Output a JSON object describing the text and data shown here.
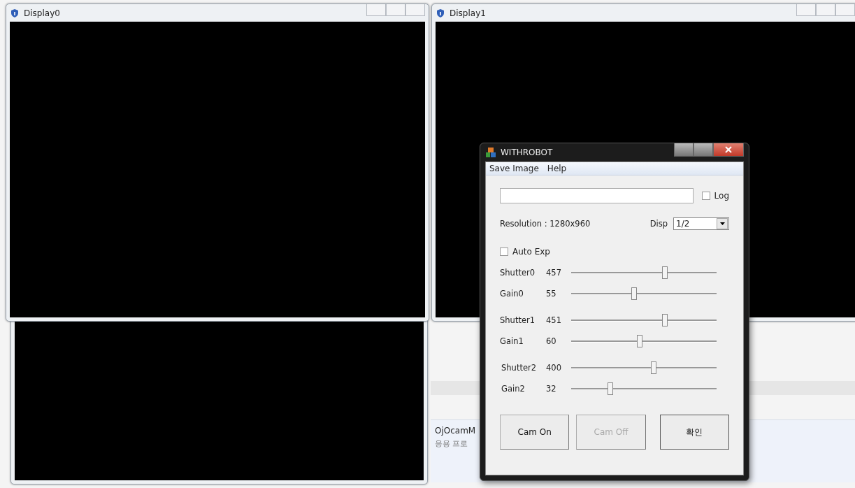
{
  "display_windows": [
    {
      "title": "Display0"
    },
    {
      "title": "Display1"
    }
  ],
  "background_item": {
    "title": "OjOcamM",
    "subtitle": "응용 프로"
  },
  "dialog": {
    "title": "WITHROBOT",
    "menu": [
      "Save Image",
      "Help"
    ],
    "log": {
      "label": "Log",
      "checked": false
    },
    "resolution": "Resolution : 1280x960",
    "disp": {
      "label": "Disp",
      "value": "1/2"
    },
    "auto_exp": {
      "label": "Auto Exp",
      "checked": false
    },
    "sliders": [
      {
        "name": "Shutter0",
        "reading": "457",
        "level": 0.65
      },
      {
        "name": "Gain0",
        "reading": "55",
        "level": 0.43
      },
      {
        "name": "Shutter1",
        "reading": "451",
        "level": 0.65
      },
      {
        "name": "Gain1",
        "reading": "60",
        "level": 0.47
      },
      {
        "name": "Shutter2",
        "reading": "400",
        "level": 0.57
      },
      {
        "name": "Gain2",
        "reading": "32",
        "level": 0.26
      }
    ],
    "buttons": [
      {
        "label": "Cam On",
        "disabled": false
      },
      {
        "label": "Cam Off",
        "disabled": true
      },
      {
        "label": "확인",
        "disabled": false
      }
    ]
  }
}
